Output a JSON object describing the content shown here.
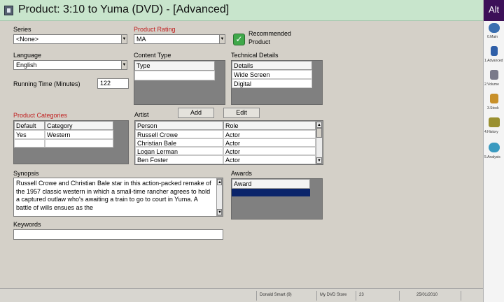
{
  "window": {
    "title": "Product: 3:10 to Yuma (DVD) - [Advanced]"
  },
  "sidebar": {
    "title": "Alt",
    "items": [
      {
        "label": "0.Main",
        "icon": "globe-icon",
        "color": "#3a6fb0"
      },
      {
        "label": "1.Advanced",
        "icon": "advanced-icon",
        "color": "#2f5fa8"
      },
      {
        "label": "2.Volume",
        "icon": "volume-icon",
        "color": "#7a7a8a"
      },
      {
        "label": "3.Stock",
        "icon": "stock-icon",
        "color": "#c8902a"
      },
      {
        "label": "4.History",
        "icon": "history-icon",
        "color": "#9a9030"
      },
      {
        "label": "5.Analysis",
        "icon": "analysis-icon",
        "color": "#3a9ac0"
      }
    ]
  },
  "form": {
    "series": {
      "label": "Series",
      "value": "<None>"
    },
    "rating": {
      "label": "Product Rating",
      "value": "MA"
    },
    "recommended": {
      "label_line1": "Recommended",
      "label_line2": "Product",
      "checked": true
    },
    "language": {
      "label": "Language",
      "value": "English"
    },
    "running_time": {
      "label": "Running Time (Minutes)",
      "value": "122"
    },
    "content_type": {
      "label": "Content Type",
      "header": "Type"
    },
    "technical": {
      "label": "Technical Details",
      "header": "Details",
      "rows": [
        "Wide Screen",
        "Digital"
      ]
    },
    "categories": {
      "label": "Product Categories",
      "headers": [
        "Default",
        "Category"
      ],
      "rows": [
        {
          "default": "Yes",
          "category": "Western"
        }
      ]
    },
    "artist": {
      "label": "Artist",
      "add_label": "Add",
      "edit_label": "Edit",
      "headers": [
        "Person",
        "Role"
      ],
      "rows": [
        {
          "person": "Russell Crowe",
          "role": "Actor"
        },
        {
          "person": "Christian Bale",
          "role": "Actor"
        },
        {
          "person": "Logan Lerman",
          "role": "Actor"
        },
        {
          "person": "Ben Foster",
          "role": "Actor"
        }
      ]
    },
    "synopsis": {
      "label": "Synopsis",
      "text": "Russell Crowe and Christian Bale star in this action-packed remake of the 1957 classic western in which a small-time rancher agrees to hold a captured outlaw who's awaiting a train to go to court in Yuma. A battle of wills ensues as the"
    },
    "awards": {
      "label": "Awards",
      "header": "Award"
    },
    "keywords": {
      "label": "Keywords",
      "value": ""
    }
  },
  "status": {
    "user": "Donald Smart (9)",
    "store": "My DVD Store",
    "store_number": "23",
    "date": "25/01/2010"
  },
  "colors": {
    "title_bg": "#c8e5cc",
    "sidebar_title_bg": "#3c1058",
    "required_label": "#c02020",
    "selected_row": "#0a246a",
    "recommended_check": "#3fa84a"
  }
}
